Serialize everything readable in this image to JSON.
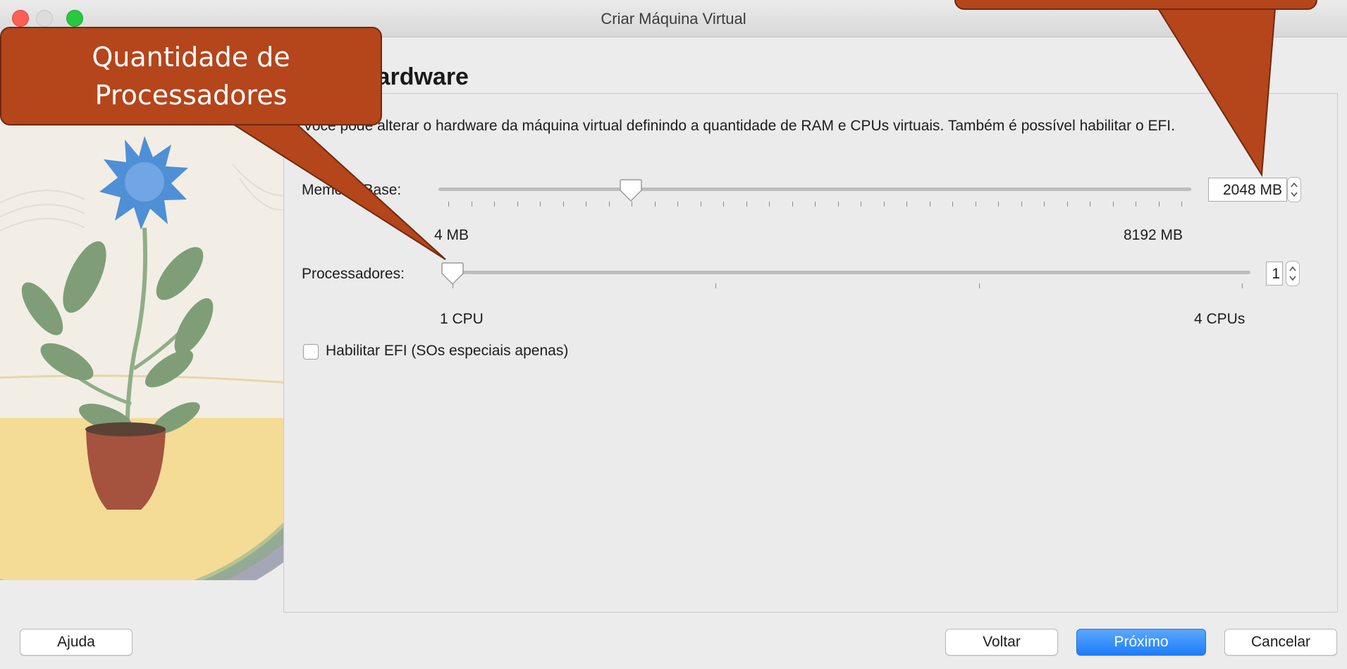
{
  "window": {
    "title": "Criar Máquina Virtual"
  },
  "page": {
    "section_title": "Hardware",
    "description": "Você pode alterar o hardware da máquina virtual definindo a quantidade de RAM e CPUs virtuais. Também é possível habilitar o EFI."
  },
  "memory": {
    "label": "Memória Base:",
    "value": "2048 MB",
    "min_label": "4 MB",
    "max_label": "8192 MB",
    "value_fraction": 0.25
  },
  "processors": {
    "label": "Processadores:",
    "value": "1",
    "min_label": "1 CPU",
    "max_label": "4 CPUs",
    "value_fraction": 0
  },
  "efi": {
    "label": "Habilitar EFI (SOs especiais apenas)",
    "checked": false
  },
  "buttons": {
    "help": "Ajuda",
    "back": "Voltar",
    "next": "Próximo",
    "cancel": "Cancelar"
  },
  "annotations": {
    "processors_callout": "Quantidade de Processadores",
    "color": "#b5451b"
  }
}
